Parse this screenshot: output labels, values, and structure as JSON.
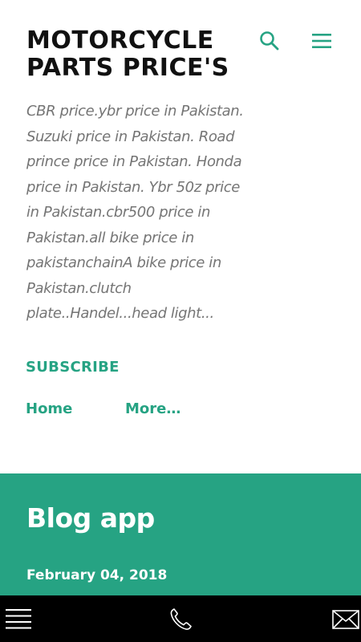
{
  "header": {
    "site_title": "MOTORCYCLE PARTS PRICE'S",
    "search_icon": "search-icon",
    "menu_icon": "hamburger-menu-icon",
    "accent_color": "#26a383",
    "description": "CBR price.ybr price in Pakistan. Suzuki price in Pakistan. Road prince price in Pakistan. Honda price in Pakistan. Ybr 50z price in Pakistan.cbr500 price in Pakistan.all bike price in pakistanchainA bike price in Pakistan.clutch plate..Handel...head light...",
    "subscribe_label": "SUBSCRIBE"
  },
  "nav": {
    "items": [
      {
        "label": "Home"
      },
      {
        "label": "More…"
      }
    ]
  },
  "post": {
    "band_color": "#26a383",
    "title": "Blog app",
    "date": "February 04, 2018"
  },
  "bottom_bar": {
    "background": "#000000",
    "icons": [
      "menu-icon",
      "phone-icon",
      "mail-icon"
    ]
  }
}
